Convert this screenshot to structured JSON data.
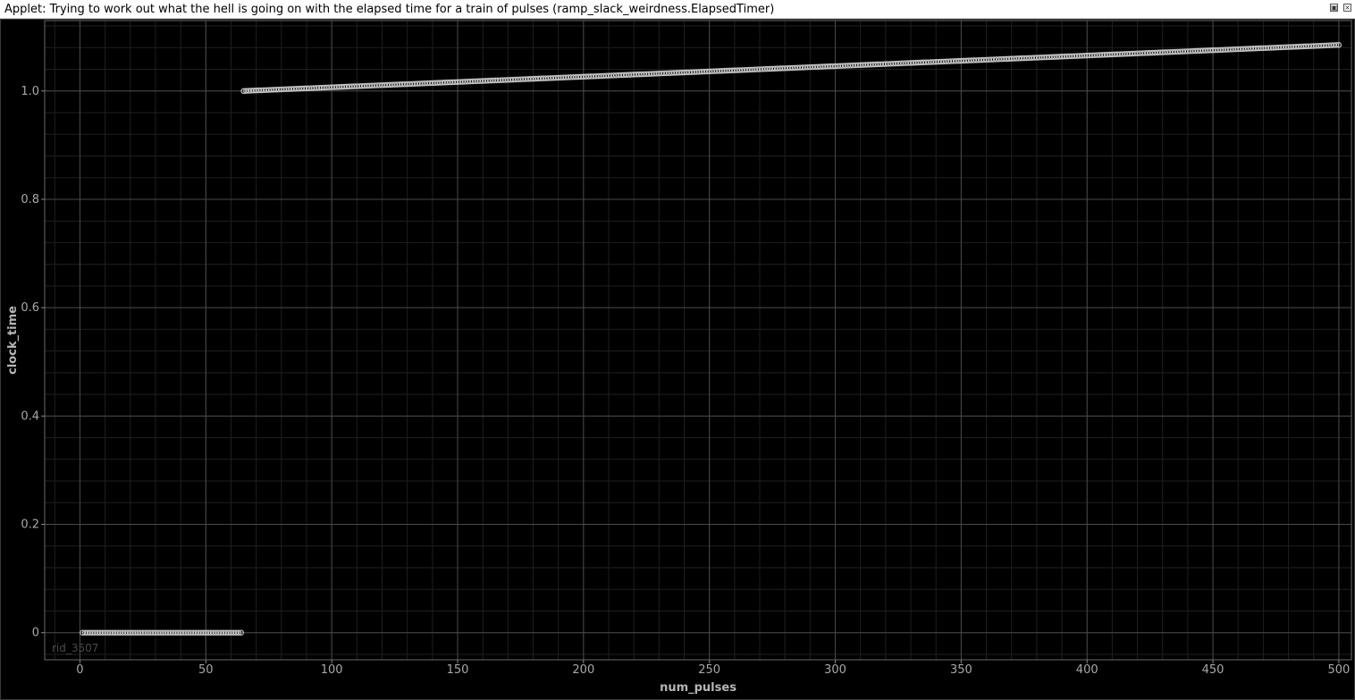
{
  "window": {
    "title": "Applet: Trying to work out what the hell is going on with the elapsed time for a train of pulses (ramp_slack_weirdness.ElapsedTimer)",
    "restore_icon": "restore-icon",
    "close_icon": "close-icon"
  },
  "plot": {
    "watermark": "rid_3507",
    "background": "#000000",
    "marker_color": "#d9d9d9"
  },
  "chart_data": {
    "type": "scatter",
    "xlabel": "num_pulses",
    "ylabel": "clock_time",
    "xlim": [
      -14,
      505
    ],
    "ylim": [
      -0.05,
      1.13
    ],
    "xticks": [
      0,
      50,
      100,
      150,
      200,
      250,
      300,
      350,
      400,
      450,
      500
    ],
    "xtick_labels": [
      "0",
      "50",
      "100",
      "150",
      "200",
      "250",
      "300",
      "350",
      "400",
      "450",
      "500"
    ],
    "yticks": [
      0,
      0.2,
      0.4,
      0.6,
      0.8,
      1.0
    ],
    "ytick_labels": [
      "0",
      "0.2",
      "0.4",
      "0.6",
      "0.8",
      "1.0"
    ],
    "grid": true,
    "series": [
      {
        "segments": [
          {
            "x_start": 1,
            "x_end": 64,
            "y_start": 0.0,
            "y_end": 0.0
          },
          {
            "x_start": 65,
            "x_end": 500,
            "y_start": 1.0,
            "y_end": 1.085
          }
        ]
      }
    ]
  }
}
